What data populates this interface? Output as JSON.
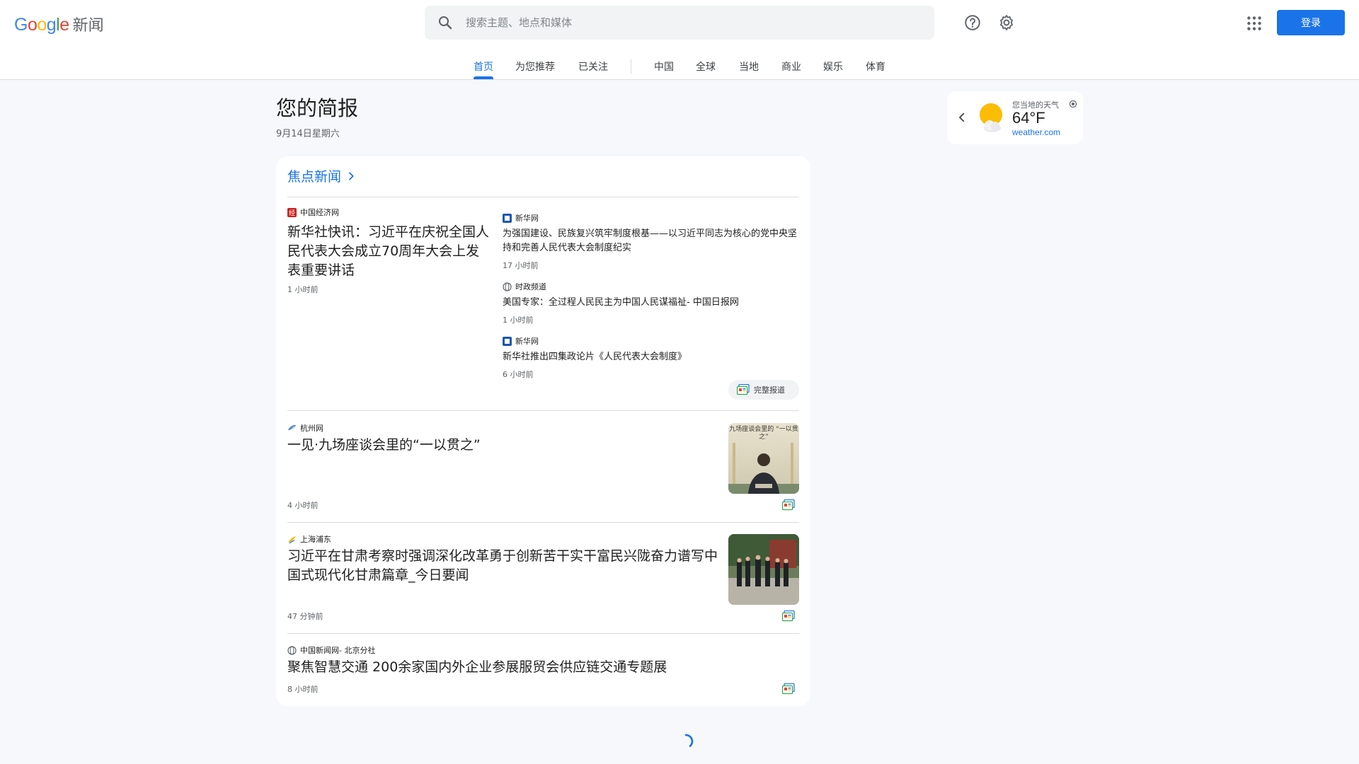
{
  "header": {
    "logo_letters": [
      "G",
      "o",
      "o",
      "g",
      "l",
      "e"
    ],
    "logo_suffix": "新闻",
    "search_placeholder": "搜索主题、地点和媒体",
    "login_label": "登录"
  },
  "nav": {
    "tabs": [
      "首页",
      "为您推荐",
      "已关注",
      "中国",
      "全球",
      "当地",
      "商业",
      "娱乐",
      "体育"
    ],
    "active": "首页"
  },
  "briefing": {
    "title": "您的简报",
    "date": "9月14日星期六"
  },
  "weather": {
    "label": "您当地的天气",
    "temp": "64°F",
    "source": "weather.com"
  },
  "top_stories": {
    "heading": "焦点新闻",
    "lead": {
      "source": "中国经济网",
      "title": "新华社快讯：习近平在庆祝全国人民代表大会成立70周年大会上发表重要讲话",
      "time": "1 小时前"
    },
    "related": [
      {
        "source": "新华网",
        "title": "为强国建设、民族复兴筑牢制度根基——以习近平同志为核心的党中央坚持和完善人民代表大会制度纪实",
        "time": "17 小时前"
      },
      {
        "source": "时政频道",
        "title": "美国专家：全过程人民民主为中国人民谋福祉- 中国日报网",
        "time": "1 小时前"
      },
      {
        "source": "新华网",
        "title": "新华社推出四集政论片《人民代表大会制度》",
        "time": "6 小时前"
      }
    ],
    "full_coverage_label": "完整报道",
    "stories": [
      {
        "source": "杭州网",
        "title": "一见·九场座谈会里的“一以贯之”",
        "time": "4 小时前",
        "thumb_caption": "九场座谈会里的 “一以贯之”"
      },
      {
        "source": "上海浦东",
        "title": "习近平在甘肃考察时强调深化改革勇于创新苦干实干富民兴陇奋力谱写中国式现代化甘肃篇章_今日要闻",
        "time": "47 分钟前"
      },
      {
        "source": "中国新闻网- 北京分社",
        "title": "聚焦智慧交通 200余家国内外企业参展服贸会供应链交通专题展",
        "time": "8 小时前"
      }
    ]
  },
  "colors": {
    "accent": "#1a73e8",
    "background": "#f6f8fc",
    "card": "#ffffff"
  },
  "icons": [
    "search-icon",
    "help-icon",
    "gear-icon",
    "apps-icon",
    "chevron-left-icon",
    "weather-sun-icon",
    "location-icon",
    "chevron-right-icon",
    "full-coverage-icon",
    "loading-spinner-icon"
  ]
}
